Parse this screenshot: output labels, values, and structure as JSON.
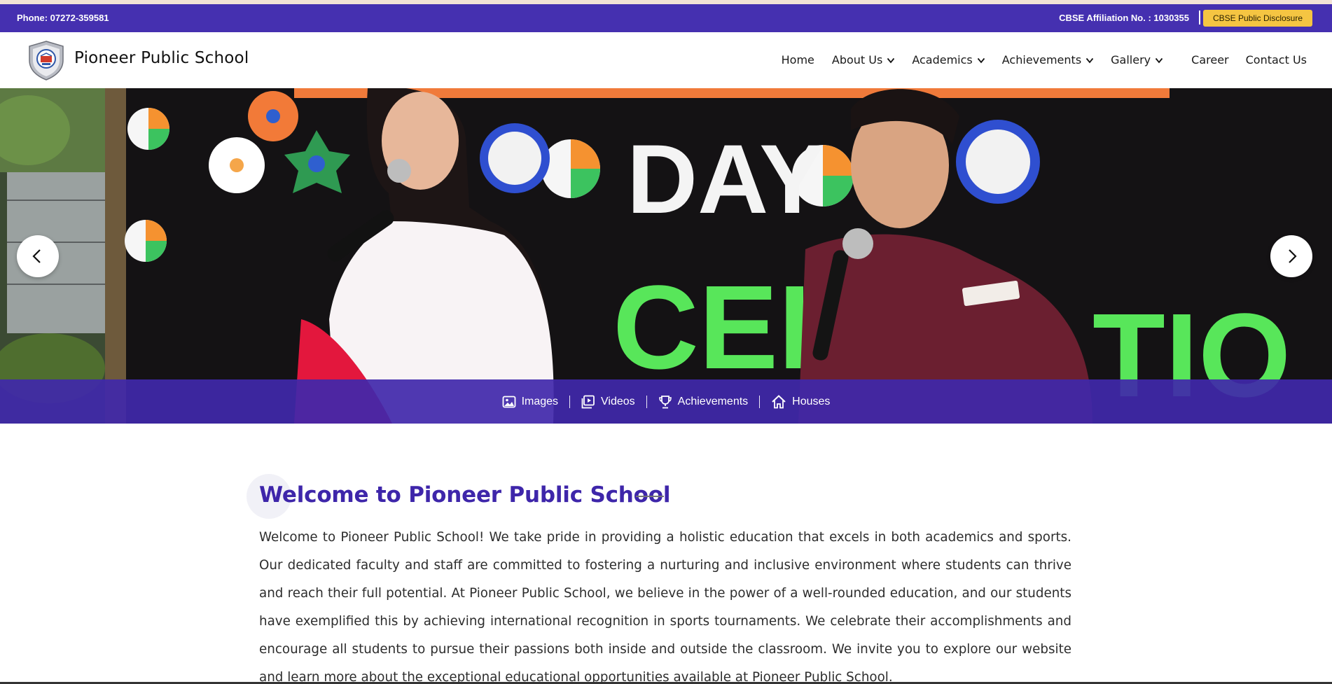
{
  "topbar": {
    "phone": "Phone: 07272-359581",
    "affiliation": "CBSE Affiliation No. : 1030355",
    "disclosure_button": "CBSE Public Disclosure"
  },
  "header": {
    "school_name": "Pioneer Public School",
    "nav": [
      {
        "label": "Home",
        "has_dropdown": false
      },
      {
        "label": "About Us",
        "has_dropdown": true
      },
      {
        "label": "Academics",
        "has_dropdown": true
      },
      {
        "label": "Achievements",
        "has_dropdown": true
      },
      {
        "label": "Gallery",
        "has_dropdown": true
      },
      {
        "label": "Career",
        "has_dropdown": false
      },
      {
        "label": "Contact Us",
        "has_dropdown": false
      }
    ]
  },
  "hero": {
    "banner_text_1": "DAY",
    "banner_text_2": "CEL",
    "banner_text_3": "TIO",
    "quick_links": [
      {
        "label": "Images",
        "icon": "image-icon"
      },
      {
        "label": "Videos",
        "icon": "video-icon"
      },
      {
        "label": "Achievements",
        "icon": "trophy-icon"
      },
      {
        "label": "Houses",
        "icon": "house-icon"
      }
    ]
  },
  "welcome": {
    "title": "Welcome to Pioneer Public School",
    "body": "Welcome to Pioneer Public School! We take pride in providing a holistic education that excels in both academics and sports. Our dedicated faculty and staff are committed to fostering a nurturing and inclusive environment where students can thrive and reach their full potential. At Pioneer Public School, we believe in the power of a well-rounded education, and our students have exemplified this by achieving international recognition in sports tournaments. We celebrate their accomplishments and encourage all students to pursue their passions both inside and outside the classroom. We invite you to explore our website and learn more about the exceptional educational opportunities available at Pioneer Public School."
  },
  "colors": {
    "primary": "#4530b0",
    "accent": "#f5c542",
    "heading": "#3e26aa"
  }
}
